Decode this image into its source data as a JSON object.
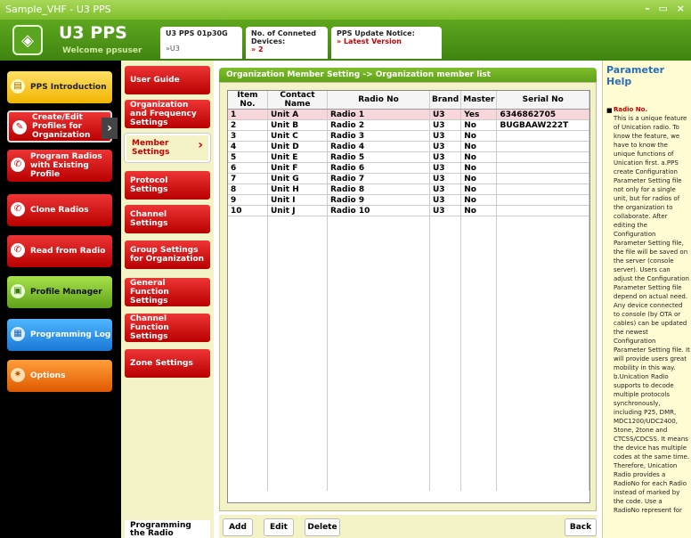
{
  "window": {
    "title": "Sample_VHF - U3 PPS",
    "controls": "– ▭ ×"
  },
  "header": {
    "brand": "U3 PPS",
    "welcome": "Welcome ppsuser",
    "version_box": {
      "label": "U3 PPS 01p30G",
      "link": "»U3"
    },
    "devices_box": {
      "label": "No. of Conneted Devices:",
      "value": "» 2"
    },
    "update_box": {
      "label": "PPS Update Notice:",
      "value": "» Latest Version"
    }
  },
  "leftnav": [
    {
      "label": "PPS Introduction"
    },
    {
      "label": "Create/Edit Profiles for Organization"
    },
    {
      "label": "Program Radios with Existing Profile"
    },
    {
      "label": "Clone Radios"
    },
    {
      "label": "Read from Radio"
    },
    {
      "label": "Profile Manager"
    },
    {
      "label": "Programming Log"
    },
    {
      "label": "Options"
    }
  ],
  "subnav": [
    {
      "label": "User Guide"
    },
    {
      "label": "Organization and Frequency Settings"
    },
    {
      "label": "Member Settings"
    },
    {
      "label": "Protocol Settings"
    },
    {
      "label": "Channel Settings"
    },
    {
      "label": "Group Settings for Organization"
    },
    {
      "label": "General Function Settings"
    },
    {
      "label": "Channel Function Settings"
    },
    {
      "label": "Zone Settings"
    }
  ],
  "subnav_bottom": "Programming the Radio",
  "panel": {
    "title": "Organization Member Setting -> Organization member list",
    "columns": [
      "Item No.",
      "Contact Name",
      "Radio No",
      "Brand",
      "Master",
      "Serial No"
    ],
    "rows": [
      [
        "1",
        "Unit A",
        "Radio 1",
        "U3",
        "Yes",
        "6346862705"
      ],
      [
        "2",
        "Unit B",
        "Radio 2",
        "U3",
        "No",
        "BUGBAAW222T"
      ],
      [
        "3",
        "Unit C",
        "Radio 3",
        "U3",
        "No",
        ""
      ],
      [
        "4",
        "Unit D",
        "Radio 4",
        "U3",
        "No",
        ""
      ],
      [
        "5",
        "Unit E",
        "Radio 5",
        "U3",
        "No",
        ""
      ],
      [
        "6",
        "Unit F",
        "Radio 6",
        "U3",
        "No",
        ""
      ],
      [
        "7",
        "Unit G",
        "Radio 7",
        "U3",
        "No",
        ""
      ],
      [
        "8",
        "Unit H",
        "Radio 8",
        "U3",
        "No",
        ""
      ],
      [
        "9",
        "Unit I",
        "Radio 9",
        "U3",
        "No",
        ""
      ],
      [
        "10",
        "Unit J",
        "Radio 10",
        "U3",
        "No",
        ""
      ]
    ]
  },
  "buttons": {
    "add": "Add",
    "edit": "Edit",
    "delete": "Delete",
    "back": "Back"
  },
  "help": {
    "title": "Parameter Help",
    "topic": "Radio No.",
    "text": "This is a unique feature of Unication radio. To know the feature, we have to know the unique functions of Unication first. a.PPS create Configuration Parameter Setting file not only for a single unit, but for radios of the organization to collaborate. After editing the Configuration Parameter Setting file, the file will be saved on the server (console server). Users can adjust the Configuration Parameter Setting file depend on actual need. Any device connected to console (by OTA or cables) can be updated the newest Configuration Parameter Setting file. It will provide users great mobility in this way. b.Unication Radio supports to decode multiple protocols synchronously, including P25, DMR, MDC1200/UDC2400, 5tone, 2tone and CTCSS/CDCSS. It means the device has multiple codes at the same time. Therefore, Unication Radio provides a RadioNo for each Radio instead of marked by the code. Use a RadioNo represent for"
  }
}
